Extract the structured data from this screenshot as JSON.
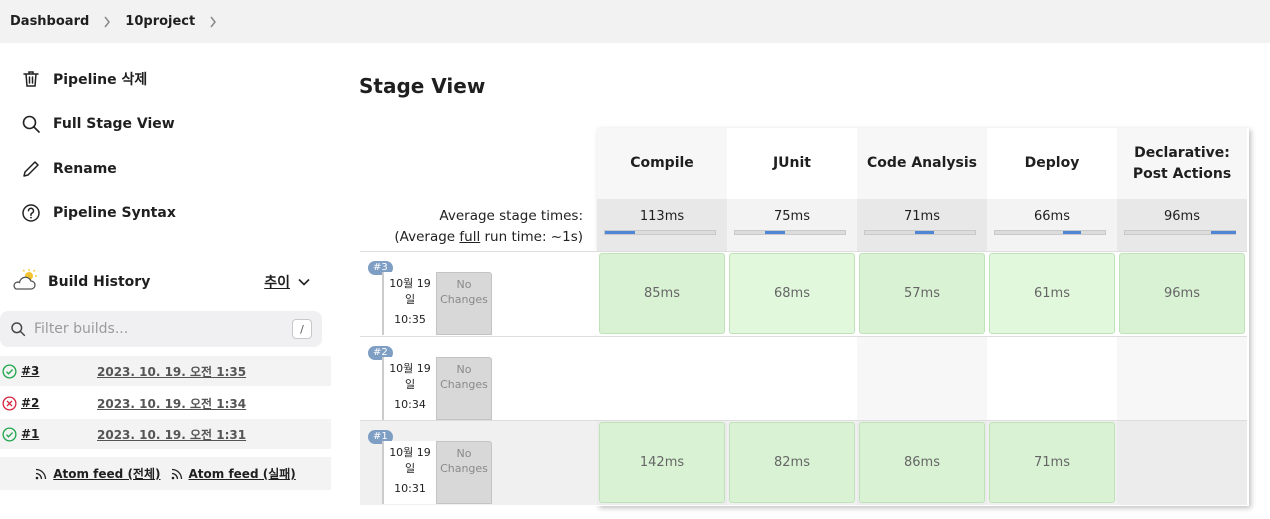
{
  "breadcrumb": [
    "Dashboard",
    "10project"
  ],
  "tasks": [
    {
      "label": "Pipeline 삭제",
      "icon": "trash-icon"
    },
    {
      "label": "Full Stage View",
      "icon": "search-icon"
    },
    {
      "label": "Rename",
      "icon": "pencil-icon"
    },
    {
      "label": "Pipeline Syntax",
      "icon": "help-circle-icon"
    }
  ],
  "build_history": {
    "title": "Build History",
    "trend": "추이",
    "filter_placeholder": "Filter builds...",
    "shortcut": "/",
    "builds": [
      {
        "number": "#3",
        "date": "2023. 10. 19. 오전 1:35",
        "status": "success"
      },
      {
        "number": "#2",
        "date": "2023. 10. 19. 오전 1:34",
        "status": "failed"
      },
      {
        "number": "#1",
        "date": "2023. 10. 19. 오전 1:31",
        "status": "success"
      }
    ],
    "feeds": [
      "Atom feed (전체)",
      "Atom feed (실패)"
    ]
  },
  "stage_view": {
    "title": "Stage View",
    "avg_label_line1": "Average stage times:",
    "avg_label_line2_prefix": "(Average ",
    "avg_label_line2_link": "full",
    "avg_label_line2_suffix": " run time: ~1s)",
    "stages": [
      {
        "name_line1": "Compile",
        "name_line2": "",
        "avg": "113ms",
        "fill": 0.27
      },
      {
        "name_line1": "JUnit",
        "name_line2": "",
        "avg": "75ms",
        "fill": 0.18
      },
      {
        "name_line1": "Code Analysis",
        "name_line2": "",
        "avg": "71ms",
        "fill": 0.17
      },
      {
        "name_line1": "Deploy",
        "name_line2": "",
        "avg": "66ms",
        "fill": 0.16
      },
      {
        "name_line1": "Declarative:",
        "name_line2": "Post Actions",
        "avg": "96ms",
        "fill": 0.23
      }
    ],
    "runs": [
      {
        "badge": "#3",
        "date": "10월 19",
        "day": "일",
        "time": "10:35",
        "changes_line1": "No",
        "changes_line2": "Changes",
        "cells": [
          "85ms",
          "68ms",
          "57ms",
          "61ms",
          "96ms"
        ]
      },
      {
        "badge": "#2",
        "date": "10월 19",
        "day": "일",
        "time": "10:34",
        "changes_line1": "No",
        "changes_line2": "Changes",
        "cells": [
          "",
          "",
          "",
          "",
          ""
        ]
      },
      {
        "badge": "#1",
        "date": "10월 19",
        "day": "일",
        "time": "10:31",
        "changes_line1": "No",
        "changes_line2": "Changes",
        "cells": [
          "142ms",
          "82ms",
          "86ms",
          "71ms",
          ""
        ]
      }
    ]
  },
  "colors": {
    "success": "#1ea64b",
    "failed": "#d4243f",
    "bar": "#4f87d6",
    "cell": "#d9f2d4"
  }
}
